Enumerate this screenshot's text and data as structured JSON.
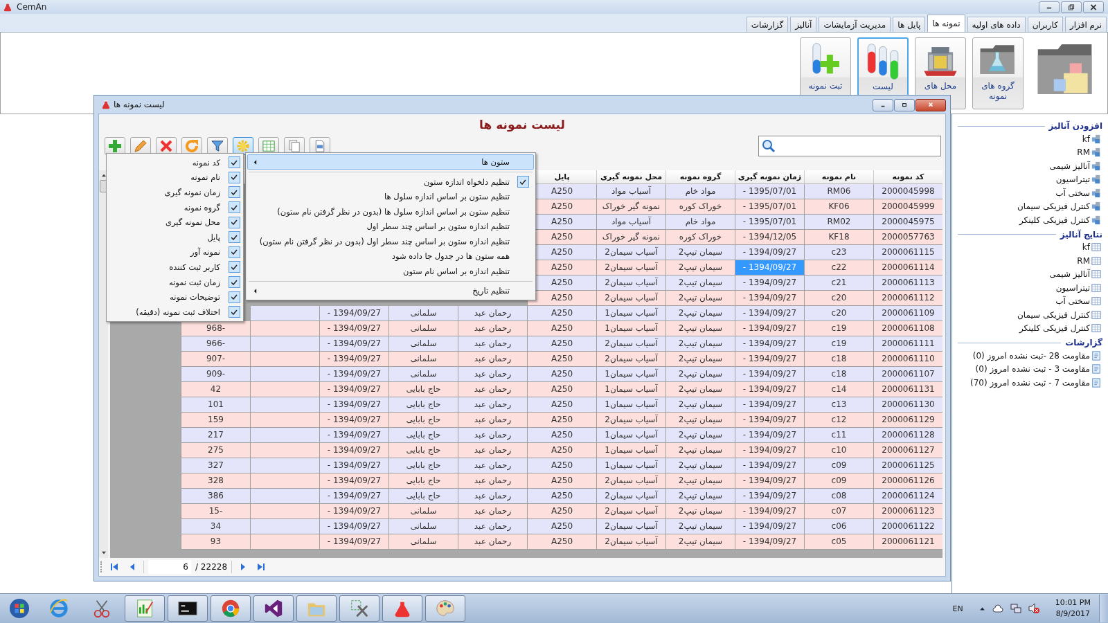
{
  "app": {
    "title": "CemAn"
  },
  "tabs": [
    {
      "label": "نرم افزار",
      "selected": false
    },
    {
      "label": "کاربران",
      "selected": false
    },
    {
      "label": "داده های اولیه",
      "selected": false
    },
    {
      "label": "نمونه ها",
      "selected": true
    },
    {
      "label": "پایل ها",
      "selected": false
    },
    {
      "label": "مدیریت آزمایشات",
      "selected": false
    },
    {
      "label": "آنالیز",
      "selected": false
    },
    {
      "label": "گزارشات",
      "selected": false
    }
  ],
  "ribbon": [
    {
      "kind": "folder-cubes",
      "selected": false
    },
    {
      "kind": "folder-flask",
      "label": "گروه های نمونه",
      "selected": false
    },
    {
      "kind": "factory",
      "label": "محل های",
      "selected": false
    },
    {
      "kind": "tubes",
      "label": "لیست",
      "selected": true
    },
    {
      "kind": "tube-add",
      "label": "ثبت نمونه",
      "selected": false
    }
  ],
  "sidebar": {
    "sections": [
      {
        "kind": "add",
        "title": "افزودن آنالیز",
        "items": [
          "kf",
          "RM",
          "آنالیز شیمی",
          "تیتراسیون",
          "سختی آب",
          "کنترل فیزیکی سیمان",
          "کنترل فیزیکی کلینکر"
        ]
      },
      {
        "kind": "results",
        "title": "نتایج آنالیز",
        "items": [
          "kf",
          "RM",
          "آنالیز شیمی",
          "تیتراسیون",
          "سختی آب",
          "کنترل فیزیکی سیمان",
          "کنترل فیزیکی کلینکر"
        ]
      },
      {
        "kind": "reports",
        "title": "گزارشات",
        "items": [
          "مقاومت 28 -ثبت نشده امروز (0)",
          "مقاومت 3 - ثبت نشده امروز (0)",
          "مقاومت 7 - ثبت نشده امروز (70)"
        ]
      }
    ]
  },
  "child_window": {
    "title": "لیست نمونه ها",
    "heading": "لیست نمونه ها",
    "toolbar": [
      {
        "kind": "add",
        "pressed": false
      },
      {
        "kind": "edit",
        "pressed": false
      },
      {
        "kind": "delete",
        "pressed": false
      },
      {
        "kind": "refresh",
        "pressed": false
      },
      {
        "kind": "filter",
        "pressed": false
      },
      {
        "kind": "settings",
        "pressed": true
      },
      {
        "kind": "excel",
        "pressed": false
      },
      {
        "kind": "copy",
        "pressed": false
      },
      {
        "kind": "document",
        "pressed": false
      }
    ],
    "table": {
      "columns": [
        "کد نمونه",
        "نام نمونه",
        "زمان نمونه گیری",
        "گروه نمونه",
        "محل نمونه گیری",
        "پایل"
      ],
      "rows": [
        {
          "selected": false,
          "cells": [
            "2000045998",
            "RM06",
            "- 1395/07/01",
            "مواد خام",
            "آسیاب مواد",
            "A250"
          ]
        },
        {
          "selected": false,
          "cells": [
            "2000045999",
            "KF06",
            "- 1395/07/01",
            "خوراک کوره",
            "نمونه گیر خوراک",
            "A250"
          ]
        },
        {
          "selected": false,
          "cells": [
            "2000045975",
            "RM02",
            "- 1395/07/01",
            "مواد خام",
            "آسیاب مواد",
            "A250"
          ]
        },
        {
          "selected": false,
          "cells": [
            "2000057763",
            "KF18",
            "- 1394/12/05",
            "خوراک کوره",
            "نمونه گیر خوراک",
            "A250"
          ]
        },
        {
          "selected": false,
          "cells": [
            "2000061115",
            "c23",
            "- 1394/09/27",
            "سیمان تیپ2",
            "آسیاب سیمان2",
            "A250"
          ]
        },
        {
          "selected": true,
          "cells": [
            "2000061114",
            "c22",
            "- 1394/09/27",
            "سیمان تیپ2",
            "آسیاب سیمان2",
            "A250"
          ]
        },
        {
          "selected": false,
          "cells": [
            "2000061113",
            "c21",
            "- 1394/09/27",
            "سیمان تیپ2",
            "آسیاب سیمان2",
            "A250"
          ]
        },
        {
          "selected": false,
          "cells": [
            "2000061112",
            "c20",
            "- 1394/09/27",
            "سیمان تیپ2",
            "آسیاب سیمان2",
            "A250"
          ]
        },
        {
          "selected": false,
          "cells": [
            "2000061109",
            "c20",
            "- 1394/09/27",
            "سیمان تیپ2",
            "آسیاب سیمان1",
            "A250",
            "رحمان عبد",
            "سلمانی",
            "- 1394/09/27",
            null
          ]
        },
        {
          "selected": false,
          "cells": [
            "2000061108",
            "c19",
            "- 1394/09/27",
            "سیمان تیپ2",
            "آسیاب سیمان1",
            "A250",
            "رحمان عبد",
            "سلمانی",
            "- 1394/09/27",
            null,
            "968-"
          ]
        },
        {
          "selected": false,
          "cells": [
            "2000061111",
            "c19",
            "- 1394/09/27",
            "سیمان تیپ2",
            "آسیاب سیمان2",
            "A250",
            "رحمان عبد",
            "سلمانی",
            "- 1394/09/27",
            null,
            "966-"
          ]
        },
        {
          "selected": false,
          "cells": [
            "2000061110",
            "c18",
            "- 1394/09/27",
            "سیمان تیپ2",
            "آسیاب سیمان2",
            "A250",
            "رحمان عبد",
            "سلمانی",
            "- 1394/09/27",
            null,
            "907-"
          ]
        },
        {
          "selected": false,
          "cells": [
            "2000061107",
            "c18",
            "- 1394/09/27",
            "سیمان تیپ2",
            "آسیاب سیمان1",
            "A250",
            "رحمان عبد",
            "سلمانی",
            "- 1394/09/27",
            null,
            "909-"
          ]
        },
        {
          "selected": false,
          "cells": [
            "2000061131",
            "c14",
            "- 1394/09/27",
            "سیمان تیپ2",
            "آسیاب سیمان1",
            "A250",
            "رحمان عبد",
            "حاج بابایی",
            "- 1394/09/27",
            null,
            "42"
          ]
        },
        {
          "selected": false,
          "cells": [
            "2000061130",
            "c13",
            "- 1394/09/27",
            "سیمان تیپ2",
            "آسیاب سیمان1",
            "A250",
            "رحمان عبد",
            "حاج بابایی",
            "- 1394/09/27",
            null,
            "101"
          ]
        },
        {
          "selected": false,
          "cells": [
            "2000061129",
            "c12",
            "- 1394/09/27",
            "سیمان تیپ2",
            "آسیاب سیمان2",
            "A250",
            "رحمان عبد",
            "حاج بابایی",
            "- 1394/09/27",
            null,
            "159"
          ]
        },
        {
          "selected": false,
          "cells": [
            "2000061128",
            "c11",
            "- 1394/09/27",
            "سیمان تیپ2",
            "آسیاب سیمان1",
            "A250",
            "رحمان عبد",
            "حاج بابایی",
            "- 1394/09/27",
            null,
            "217"
          ]
        },
        {
          "selected": false,
          "cells": [
            "2000061127",
            "c10",
            "- 1394/09/27",
            "سیمان تیپ2",
            "آسیاب سیمان1",
            "A250",
            "رحمان عبد",
            "حاج بابایی",
            "- 1394/09/27",
            null,
            "275"
          ]
        },
        {
          "selected": false,
          "cells": [
            "2000061125",
            "c09",
            "- 1394/09/27",
            "سیمان تیپ2",
            "آسیاب سیمان1",
            "A250",
            "رحمان عبد",
            "حاج بابایی",
            "- 1394/09/27",
            null,
            "327"
          ]
        },
        {
          "selected": false,
          "cells": [
            "2000061126",
            "c09",
            "- 1394/09/27",
            "سیمان تیپ2",
            "آسیاب سیمان2",
            "A250",
            "رحمان عبد",
            "حاج بابایی",
            "- 1394/09/27",
            null,
            "328"
          ]
        },
        {
          "selected": false,
          "cells": [
            "2000061124",
            "c08",
            "- 1394/09/27",
            "سیمان تیپ2",
            "آسیاب سیمان2",
            "A250",
            "رحمان عبد",
            "حاج بابایی",
            "- 1394/09/27",
            null,
            "386"
          ]
        },
        {
          "selected": false,
          "cells": [
            "2000061123",
            "c07",
            "- 1394/09/27",
            "سیمان تیپ2",
            "آسیاب سیمان2",
            "A250",
            "رحمان عبد",
            "سلمانی",
            "- 1394/09/27",
            null,
            "15-"
          ]
        },
        {
          "selected": false,
          "cells": [
            "2000061122",
            "c06",
            "- 1394/09/27",
            "سیمان تیپ2",
            "آسیاب سیمان2",
            "A250",
            "رحمان عبد",
            "سلمانی",
            "- 1394/09/27",
            null,
            "34"
          ]
        },
        {
          "selected": false,
          "cells": [
            "2000061121",
            "c05",
            "- 1394/09/27",
            "سیمان تیپ2",
            "آسیاب سیمان2",
            "A250",
            "رحمان عبد",
            "سلمانی",
            "- 1394/09/27",
            null,
            "93"
          ]
        }
      ]
    },
    "pager": {
      "page": "6",
      "total": "/ 22228"
    },
    "context_menu": {
      "items": [
        {
          "kind": "submenu",
          "label": "ستون ها",
          "selected": true
        },
        {
          "kind": "separator"
        },
        {
          "kind": "check",
          "label": "تنظیم دلخواه اندازه ستون",
          "checked": true
        },
        {
          "kind": "check",
          "label": "تنظیم ستون بر اساس اندازه سلول ها",
          "checked": false
        },
        {
          "kind": "check",
          "label": "تنظیم ستون بر اساس اندازه سلول ها (بدون در نظر گرفتن نام ستون)",
          "checked": false
        },
        {
          "kind": "check",
          "label": "تنظیم اندازه ستون بر اساس چند سطر اول",
          "checked": false
        },
        {
          "kind": "check",
          "label": "تنظیم اندازه ستون بر اساس چند سطر اول (بدون در نظر گرفتن نام ستون)",
          "checked": false
        },
        {
          "kind": "check",
          "label": "همه ستون ها در جدول جا داده شود",
          "checked": false
        },
        {
          "kind": "check",
          "label": "تنظیم اندازه بر اساس نام ستون",
          "checked": false
        },
        {
          "kind": "separator"
        },
        {
          "kind": "submenu",
          "label": "تنظیم تاریخ",
          "selected": false
        }
      ]
    },
    "columns_menu": {
      "items": [
        {
          "label": "کد نمونه",
          "checked": true
        },
        {
          "label": "نام نمونه",
          "checked": true
        },
        {
          "label": "زمان نمونه گیری",
          "checked": true
        },
        {
          "label": "گروه نمونه",
          "checked": true
        },
        {
          "label": "محل نمونه گیری",
          "checked": true
        },
        {
          "label": "پایل",
          "checked": true
        },
        {
          "label": "نمونه آور",
          "checked": true
        },
        {
          "label": "کاربر ثبت کننده",
          "checked": true
        },
        {
          "label": "زمان ثبت نمونه",
          "checked": true
        },
        {
          "label": "توضیحات نمونه",
          "checked": true
        },
        {
          "label": "اختلاف ثبت نمونه (دقیقه)",
          "checked": true
        }
      ]
    }
  },
  "taskbar": {
    "apps": [
      {
        "kind": "browser",
        "active": false
      },
      {
        "kind": "snip",
        "active": false
      },
      {
        "kind": "chart",
        "active": true
      },
      {
        "kind": "console",
        "active": true
      },
      {
        "kind": "chrome",
        "active": true
      },
      {
        "kind": "studio",
        "active": true
      },
      {
        "kind": "explorer",
        "active": true
      },
      {
        "kind": "tools",
        "active": true
      },
      {
        "kind": "flask",
        "active": true
      },
      {
        "kind": "paint",
        "active": true
      }
    ],
    "language": "EN",
    "time": "10:01 PM",
    "date": "8/9/2017"
  }
}
